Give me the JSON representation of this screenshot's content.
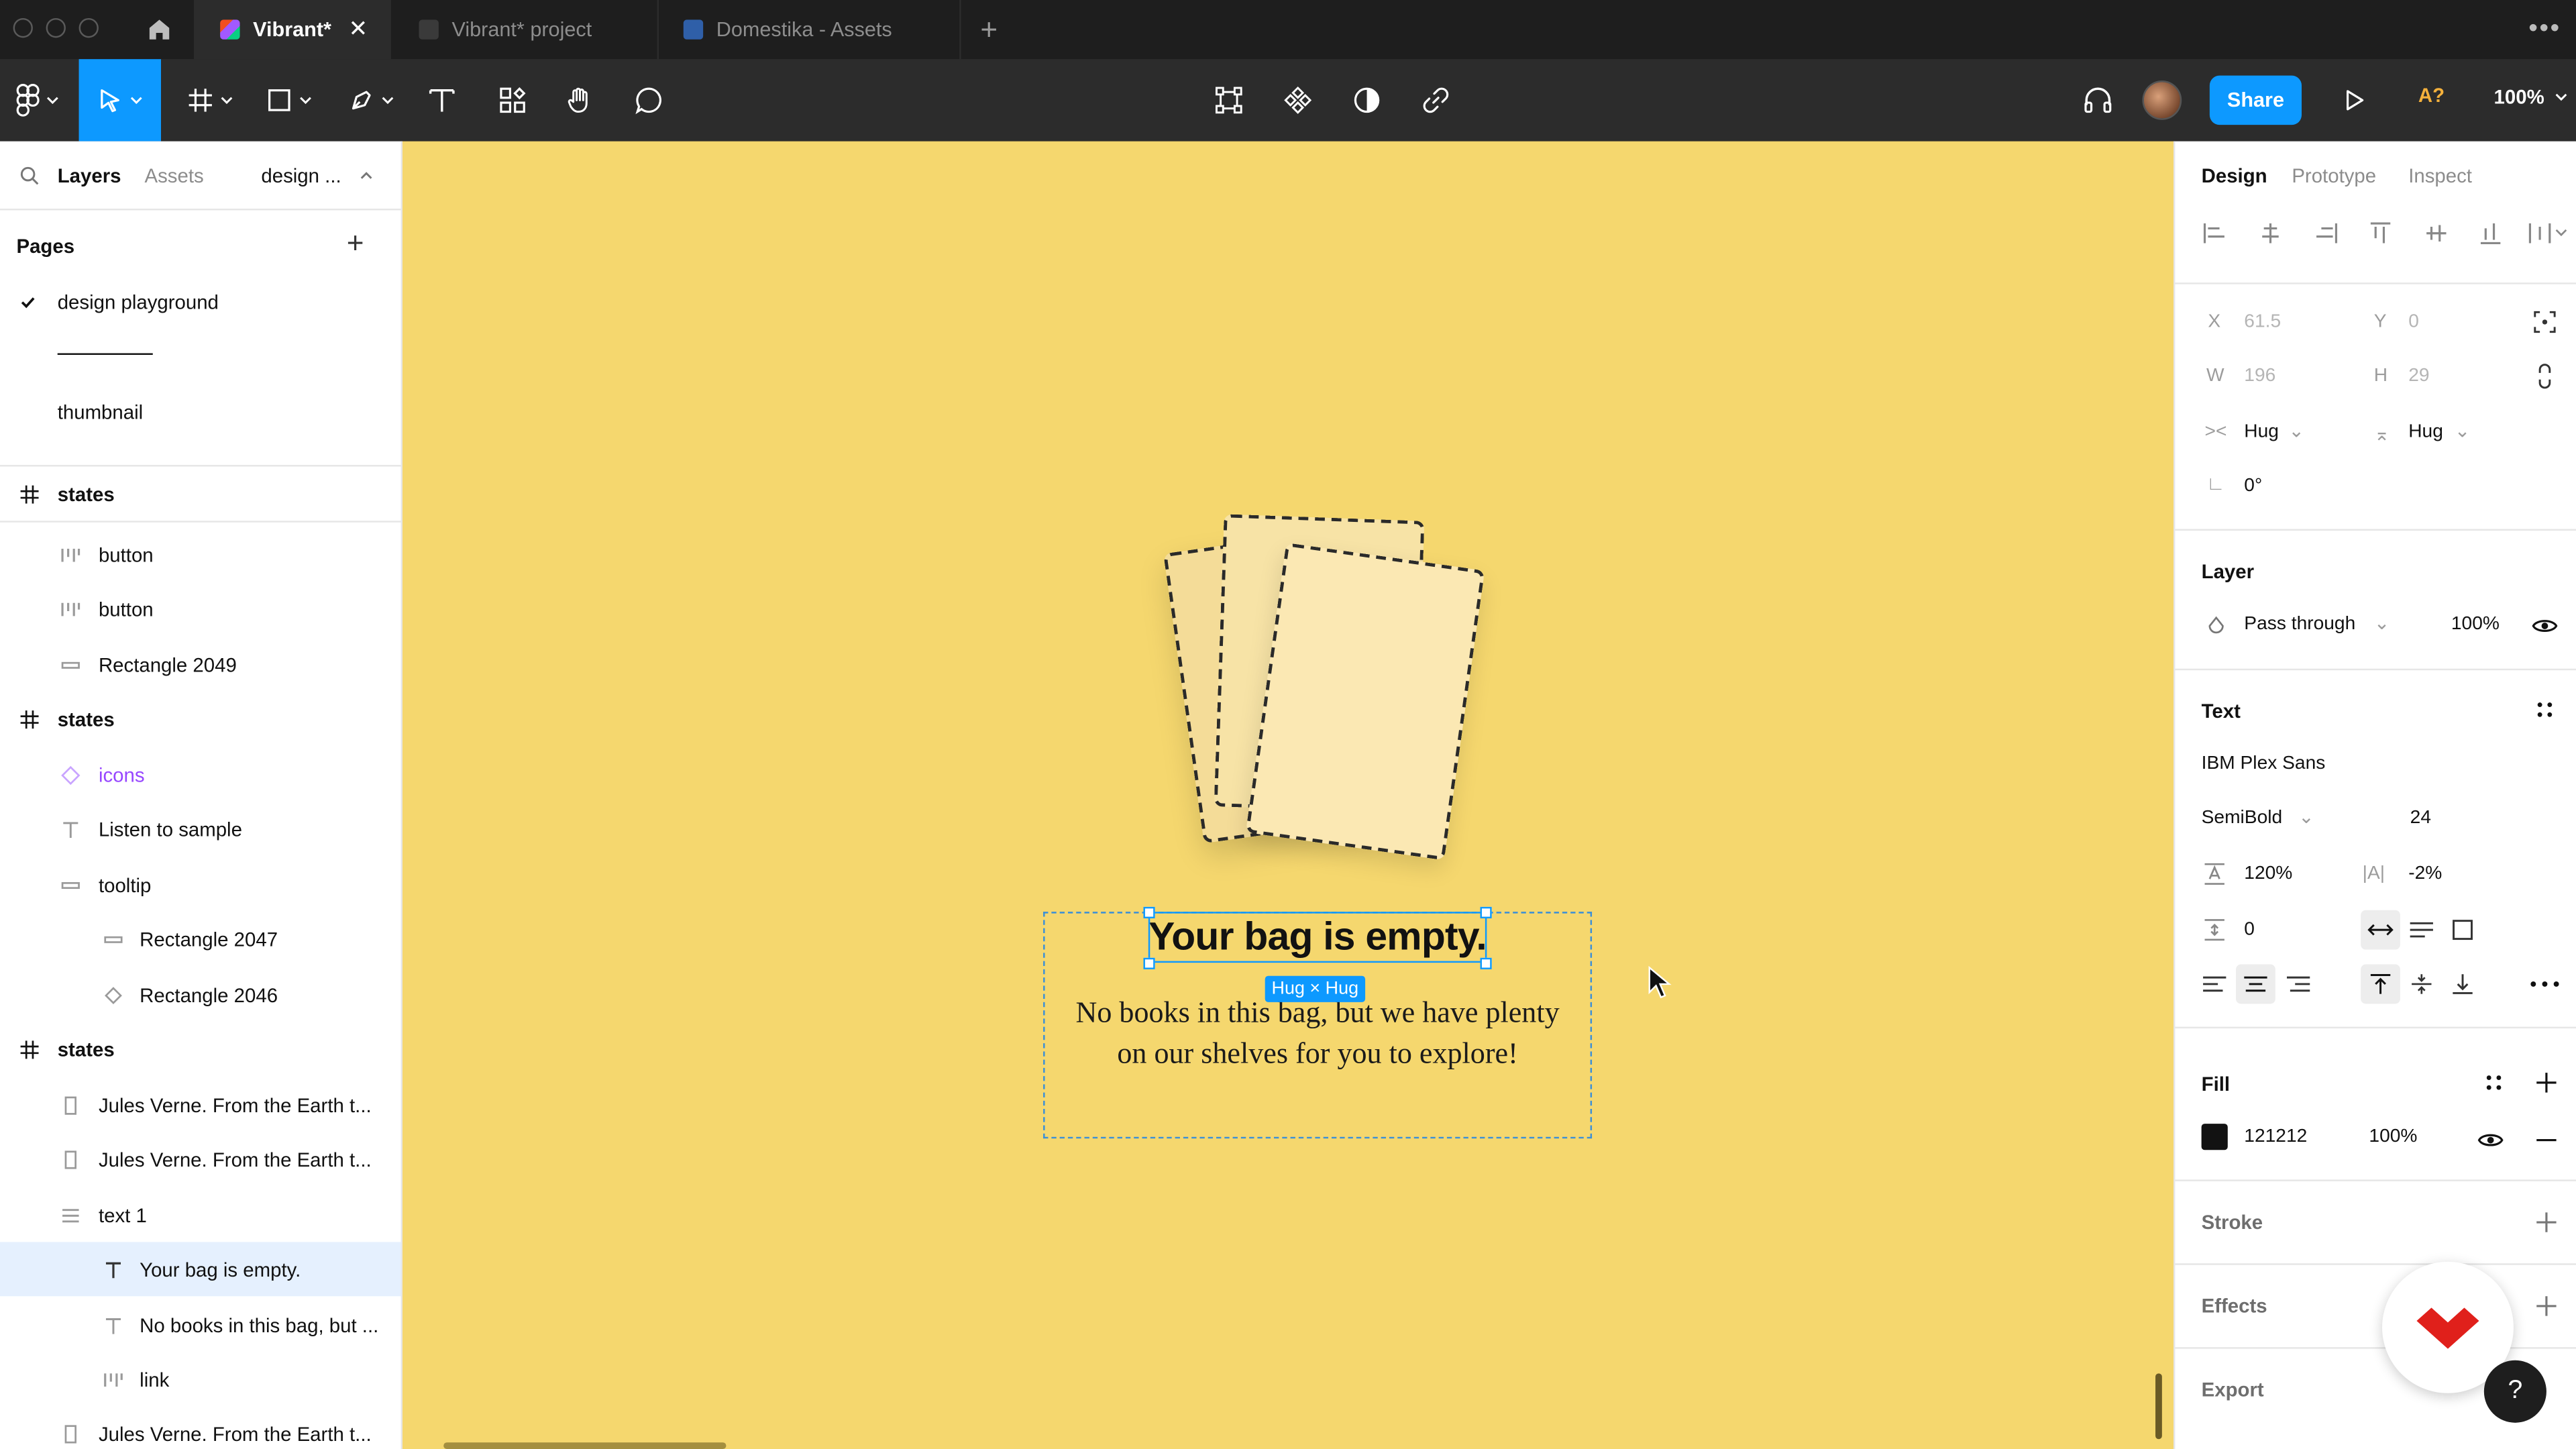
{
  "window": {
    "tabs": [
      {
        "label": "Vibrant*",
        "active": true
      },
      {
        "label": "Vibrant* project",
        "active": false
      },
      {
        "label": "Domestika - Assets",
        "active": false
      }
    ]
  },
  "toolbar": {
    "share_label": "Share",
    "missing_fonts_label": "A?",
    "zoom_label": "100%"
  },
  "left_panel": {
    "tabs": {
      "layers": "Layers",
      "assets": "Assets",
      "page_switch": "design ..."
    },
    "pages_title": "Pages",
    "pages": [
      {
        "label": "design playground",
        "current": true
      },
      {
        "label": "thumbnail",
        "current": false
      }
    ],
    "layers": [
      {
        "label": "states",
        "icon": "frame-icon"
      },
      {
        "label": "button",
        "icon": "component-instance-icon"
      },
      {
        "label": "button",
        "icon": "component-instance-icon"
      },
      {
        "label": "Rectangle 2049",
        "icon": "rectangle-icon"
      },
      {
        "label": "states",
        "icon": "frame-icon"
      },
      {
        "label": "icons",
        "icon": "component-icon"
      },
      {
        "label": "Listen to sample",
        "icon": "text-icon"
      },
      {
        "label": "tooltip",
        "icon": "rectangle-icon"
      },
      {
        "label": "Rectangle 2047",
        "icon": "rectangle-icon"
      },
      {
        "label": "Rectangle 2046",
        "icon": "diamond-icon"
      },
      {
        "label": "states",
        "icon": "frame-icon"
      },
      {
        "label": "Jules Verne. From the Earth t...",
        "icon": "page-icon"
      },
      {
        "label": "Jules Verne. From the Earth t...",
        "icon": "page-icon"
      },
      {
        "label": "text 1",
        "icon": "auto-layout-icon"
      },
      {
        "label": "Your bag is empty.",
        "icon": "text-icon",
        "selected": true
      },
      {
        "label": "No books in this bag, but ...",
        "icon": "text-icon"
      },
      {
        "label": "link",
        "icon": "component-instance-icon"
      },
      {
        "label": "Jules Verne. From the Earth t...",
        "icon": "page-icon"
      }
    ]
  },
  "canvas": {
    "background": "#f5d76e",
    "heading": "Your bag is empty.",
    "body_line1": "No books in this bag, but we have plenty",
    "body_line2": "on our shelves for you to explore!",
    "hug_badge": "Hug × Hug"
  },
  "right_panel": {
    "tabs": {
      "design": "Design",
      "prototype": "Prototype",
      "inspect": "Inspect"
    },
    "position": {
      "x_label": "X",
      "x_value": "61.5",
      "y_label": "Y",
      "y_value": "0"
    },
    "size": {
      "w_label": "W",
      "w_value": "196",
      "h_label": "H",
      "h_value": "29"
    },
    "resizing": {
      "horizontal": "Hug",
      "vertical": "Hug"
    },
    "rotation": "0°",
    "layer": {
      "title": "Layer",
      "blend_mode": "Pass through",
      "opacity": "100%"
    },
    "text": {
      "title": "Text",
      "font_family": "IBM Plex Sans",
      "font_weight": "SemiBold",
      "font_size": "24",
      "line_height": "120%",
      "letter_spacing": "-2%",
      "paragraph_spacing": "0"
    },
    "fill": {
      "title": "Fill",
      "hex": "121212",
      "opacity": "100%",
      "color": "#121212"
    },
    "stroke_title": "Stroke",
    "effects_title": "Effects",
    "export_title": "Export",
    "help_label": "?"
  }
}
